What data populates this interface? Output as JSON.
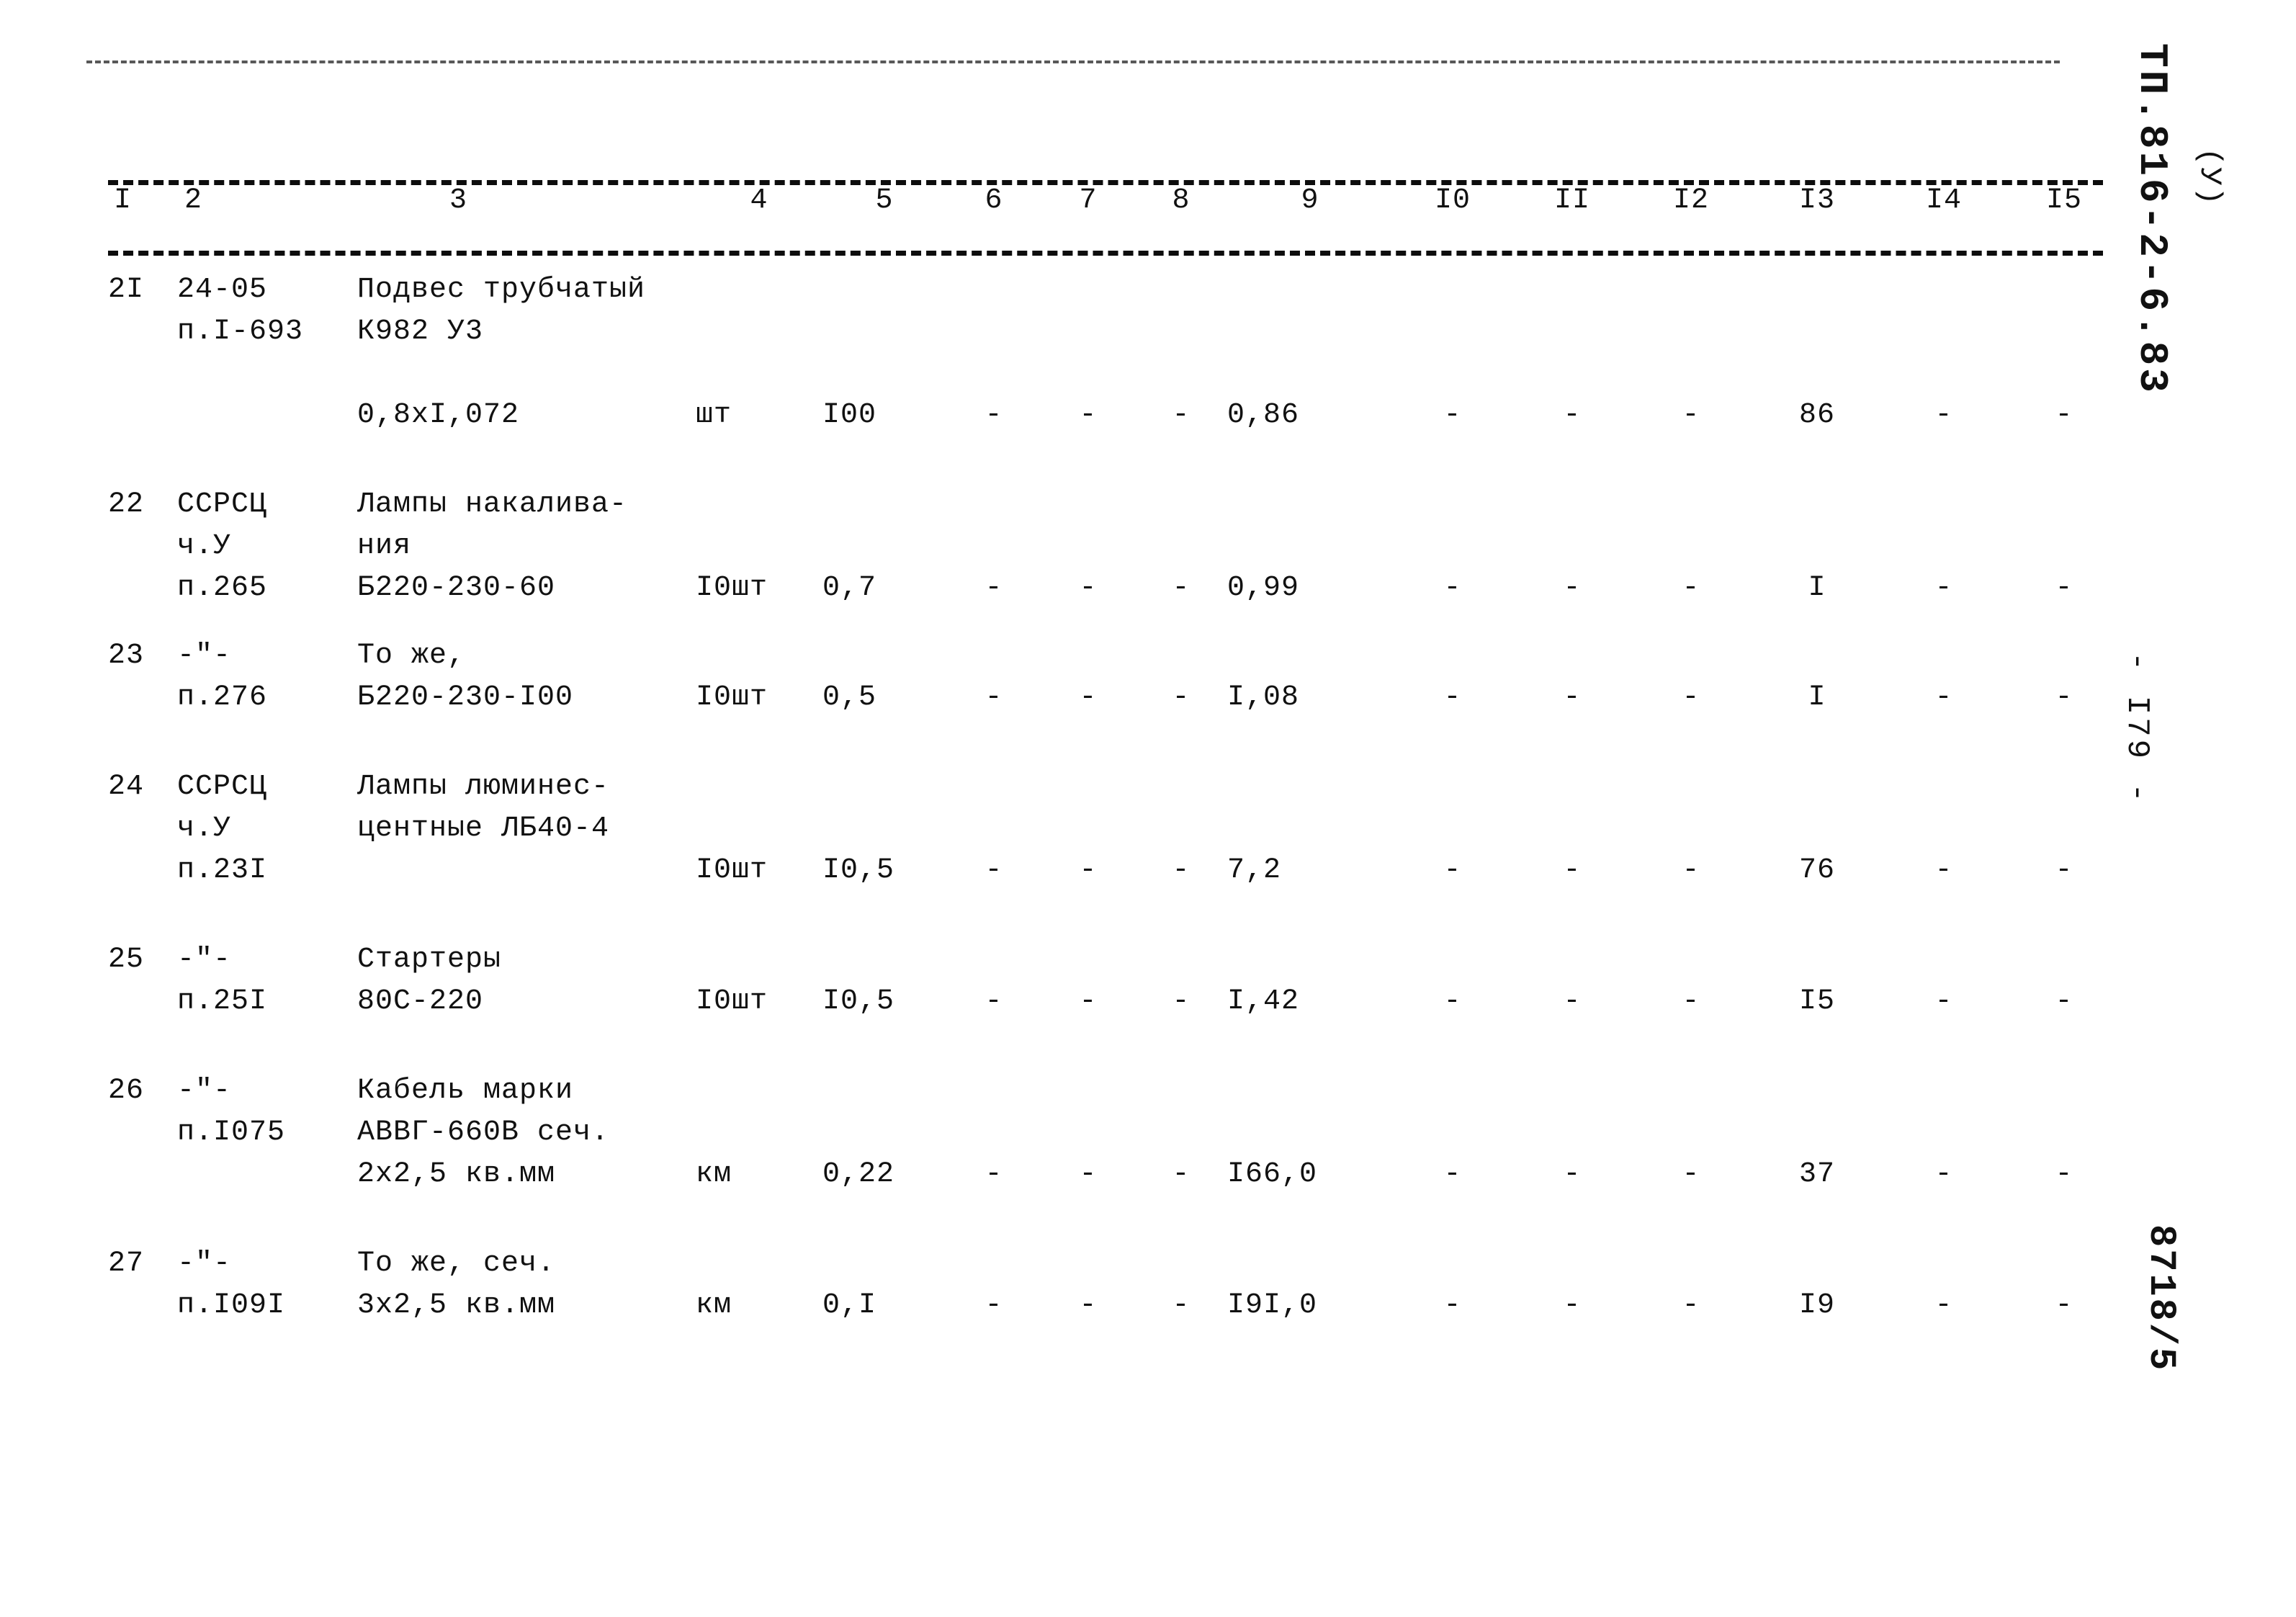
{
  "document": {
    "code": "ТП.816-2-6.83",
    "variant": "(У)",
    "page_number": "- I79 -",
    "sheet_stamp": "8718/5"
  },
  "table": {
    "column_headers": [
      "I",
      "2",
      "3",
      "4",
      "5",
      "6",
      "7",
      "8",
      "9",
      "I0",
      "II",
      "I2",
      "I3",
      "I4",
      "I5"
    ],
    "rows": [
      {
        "num": "2I",
        "code_lines": [
          "24-05",
          "п.I-693"
        ],
        "name_lines": [
          "Подвес трубчатый",
          "К982 У3",
          "",
          "0,8хI,072"
        ],
        "unit": "шт",
        "c5": "I00",
        "c6": "-",
        "c7": "-",
        "c8": "-",
        "c9": "0,86",
        "c10": "-",
        "c11": "-",
        "c12": "-",
        "c13": "86",
        "c14": "-",
        "c15": "-"
      },
      {
        "num": "22",
        "code_lines": [
          "ССРСЦ",
          "ч.У",
          "п.265"
        ],
        "name_lines": [
          "Лампы накалива-",
          "ния",
          "Б220-230-60"
        ],
        "unit": "I0шт",
        "c5": "0,7",
        "c6": "-",
        "c7": "-",
        "c8": "-",
        "c9": "0,99",
        "c10": "-",
        "c11": "-",
        "c12": "-",
        "c13": "I",
        "c14": "-",
        "c15": "-"
      },
      {
        "num": "23",
        "code_lines": [
          "-\"-",
          "п.276"
        ],
        "name_lines": [
          "То же,",
          "Б220-230-I00"
        ],
        "unit": "I0шт",
        "c5": "0,5",
        "c6": "-",
        "c7": "-",
        "c8": "-",
        "c9": "I,08",
        "c10": "-",
        "c11": "-",
        "c12": "-",
        "c13": "I",
        "c14": "-",
        "c15": "-"
      },
      {
        "num": "24",
        "code_lines": [
          "ССРСЦ",
          "ч.У",
          "п.23I"
        ],
        "name_lines": [
          "Лампы люминес-",
          "центные ЛБ40-4"
        ],
        "unit": "I0шт",
        "c5": "I0,5",
        "c6": "-",
        "c7": "-",
        "c8": "-",
        "c9": "7,2",
        "c10": "-",
        "c11": "-",
        "c12": "-",
        "c13": "76",
        "c14": "-",
        "c15": "-"
      },
      {
        "num": "25",
        "code_lines": [
          "-\"-",
          "п.25I"
        ],
        "name_lines": [
          "Стартеры",
          "80С-220"
        ],
        "unit": "I0шт",
        "c5": "I0,5",
        "c6": "-",
        "c7": "-",
        "c8": "-",
        "c9": "I,42",
        "c10": "-",
        "c11": "-",
        "c12": "-",
        "c13": "I5",
        "c14": "-",
        "c15": "-"
      },
      {
        "num": "26",
        "code_lines": [
          "-\"-",
          "п.I075"
        ],
        "name_lines": [
          "Кабель марки",
          "АВВГ-660В сеч.",
          "2х2,5 кв.мм"
        ],
        "unit": "км",
        "c5": "0,22",
        "c6": "-",
        "c7": "-",
        "c8": "-",
        "c9": "I66,0",
        "c10": "-",
        "c11": "-",
        "c12": "-",
        "c13": "37",
        "c14": "-",
        "c15": "-"
      },
      {
        "num": "27",
        "code_lines": [
          "-\"-",
          "п.I09I"
        ],
        "name_lines": [
          "То же, сеч.",
          "3х2,5 кв.мм"
        ],
        "unit": "км",
        "c5": "0,I",
        "c6": "-",
        "c7": "-",
        "c8": "-",
        "c9": "I9I,0",
        "c10": "-",
        "c11": "-",
        "c12": "-",
        "c13": "I9",
        "c14": "-",
        "c15": "-"
      }
    ]
  }
}
